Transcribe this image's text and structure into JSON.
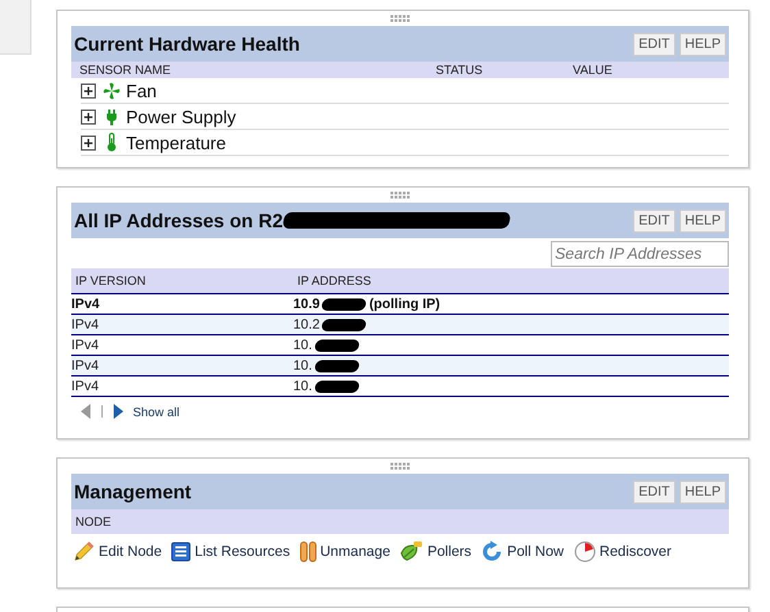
{
  "panels": [
    {
      "kind": "hardware",
      "title": "Current Hardware Health",
      "buttons": [
        "EDIT",
        "HELP"
      ],
      "columns": [
        "SENSOR NAME",
        "STATUS",
        "VALUE"
      ],
      "rows": [
        {
          "kind": "fan",
          "label": "Fan",
          "expanded": false
        },
        {
          "kind": "plug",
          "label": "Power Supply",
          "expanded": false
        },
        {
          "kind": "thermometer",
          "label": "Temperature",
          "expanded": false
        }
      ]
    },
    {
      "kind": "ip",
      "title": "All IP Addresses on R2",
      "buttons": [
        "EDIT",
        "HELP"
      ],
      "search": {
        "placeholder": "Search IP Addresses"
      },
      "columns": [
        "IP VERSION",
        "IP ADDRESS"
      ],
      "rows": [
        {
          "version": "IPv4",
          "address": "10.9",
          "note": "(polling IP)",
          "primary": true
        },
        {
          "version": "IPv4",
          "address": "10.2",
          "primary": false
        },
        {
          "version": "IPv4",
          "address": "10.",
          "primary": false
        },
        {
          "version": "IPv4",
          "address": "10.",
          "primary": false
        },
        {
          "version": "IPv4",
          "address": "10.",
          "primary": false
        }
      ],
      "pager": {
        "link": "Show all"
      }
    },
    {
      "kind": "management",
      "title": "Management",
      "buttons": [
        "EDIT",
        "HELP"
      ],
      "columns": [
        "NODE"
      ],
      "actions": [
        {
          "kind": "pencil",
          "label": "Edit Node"
        },
        {
          "kind": "list",
          "label": "List Resources"
        },
        {
          "kind": "pause",
          "label": "Unmanage"
        },
        {
          "kind": "leaf",
          "label": "Pollers"
        },
        {
          "kind": "refresh",
          "label": "Poll Now"
        },
        {
          "kind": "clock",
          "label": "Rediscover"
        }
      ]
    },
    {
      "kind": "partial"
    }
  ]
}
